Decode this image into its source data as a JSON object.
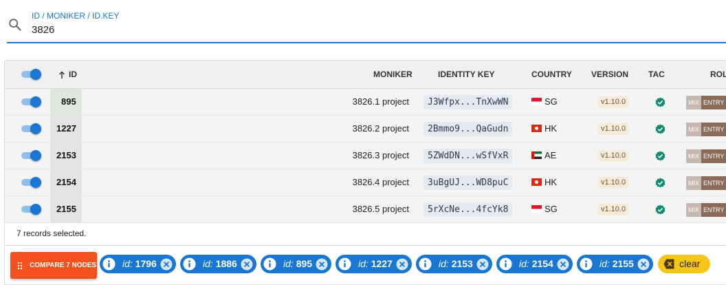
{
  "search": {
    "label": "ID / MONIKER / ID.KEY",
    "value": "3826",
    "icon": "search-icon"
  },
  "table": {
    "headers": {
      "id": "ID",
      "moniker": "MONIKER",
      "identity_key": "IDENTITY KEY",
      "country": "COUNTRY",
      "version": "VERSION",
      "tac": "TAC",
      "role": "ROLE"
    },
    "sort": {
      "column": "ID",
      "direction": "ascending",
      "icon": "arrow-up-icon"
    },
    "rows": [
      {
        "id": "895",
        "moniker": "3826.1 project",
        "identity_key": "J3Wfpx...TnXwWN",
        "country_code": "SG",
        "flag": "sg",
        "version": "v1.10.0",
        "tac": "verified",
        "role_mix": "MIX",
        "role_entry": "ENTRY",
        "selected": true
      },
      {
        "id": "1227",
        "moniker": "3826.2 project",
        "identity_key": "2Bmmo9...QaGudn",
        "country_code": "HK",
        "flag": "hk",
        "version": "v1.10.0",
        "tac": "verified",
        "role_mix": "MIX",
        "role_entry": "ENTRY",
        "selected": true
      },
      {
        "id": "2153",
        "moniker": "3826.3 project",
        "identity_key": "5ZWdDN...wSfVxR",
        "country_code": "AE",
        "flag": "ae",
        "version": "v1.10.0",
        "tac": "verified",
        "role_mix": "MIX",
        "role_entry": "ENTRY",
        "selected": true
      },
      {
        "id": "2154",
        "moniker": "3826.4 project",
        "identity_key": "3uBgUJ...WD8puC",
        "country_code": "HK",
        "flag": "hk",
        "version": "v1.10.0",
        "tac": "verified",
        "role_mix": "MIX",
        "role_entry": "ENTRY",
        "selected": true
      },
      {
        "id": "2155",
        "moniker": "3826.5 project",
        "identity_key": "5rXcNe...4fcYk8",
        "country_code": "SG",
        "flag": "sg",
        "version": "v1.10.0",
        "tac": "verified",
        "role_mix": "MIX",
        "role_entry": "ENTRY",
        "selected": true
      }
    ],
    "footer": "7 records selected."
  },
  "actions": {
    "compare_label": "COMPARE 7 NODES",
    "chip_prefix": "id:",
    "chips": [
      "1796",
      "1886",
      "895",
      "1227",
      "2153",
      "2154",
      "2155"
    ],
    "clear_label": "clear"
  },
  "colors": {
    "accent": "#1976d2",
    "compare": "#f4511e",
    "clear": "#f5c518",
    "tac_ok": "#138a6e"
  }
}
